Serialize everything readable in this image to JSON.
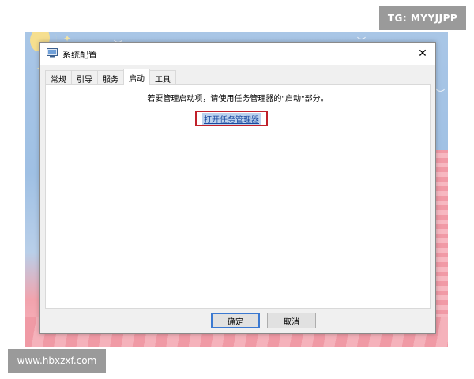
{
  "window": {
    "title": "系统配置",
    "close_glyph": "✕"
  },
  "tabs": [
    {
      "label": "常规",
      "active": false
    },
    {
      "label": "引导",
      "active": false
    },
    {
      "label": "服务",
      "active": false
    },
    {
      "label": "启动",
      "active": true
    },
    {
      "label": "工具",
      "active": false
    }
  ],
  "startup_panel": {
    "instruction": "若要管理启动项，请使用任务管理器的\"启动\"部分。",
    "open_task_manager_link": "打开任务管理器"
  },
  "buttons": {
    "ok_label": "确定",
    "cancel_label": "取消"
  },
  "watermarks": {
    "top_right": "TG: MYYJJPP",
    "bottom_left": "www.hbxzxf.com"
  },
  "colors": {
    "highlight_box": "#c0202a",
    "link": "#1a4aa0",
    "default_button_border": "#3b79d1"
  }
}
